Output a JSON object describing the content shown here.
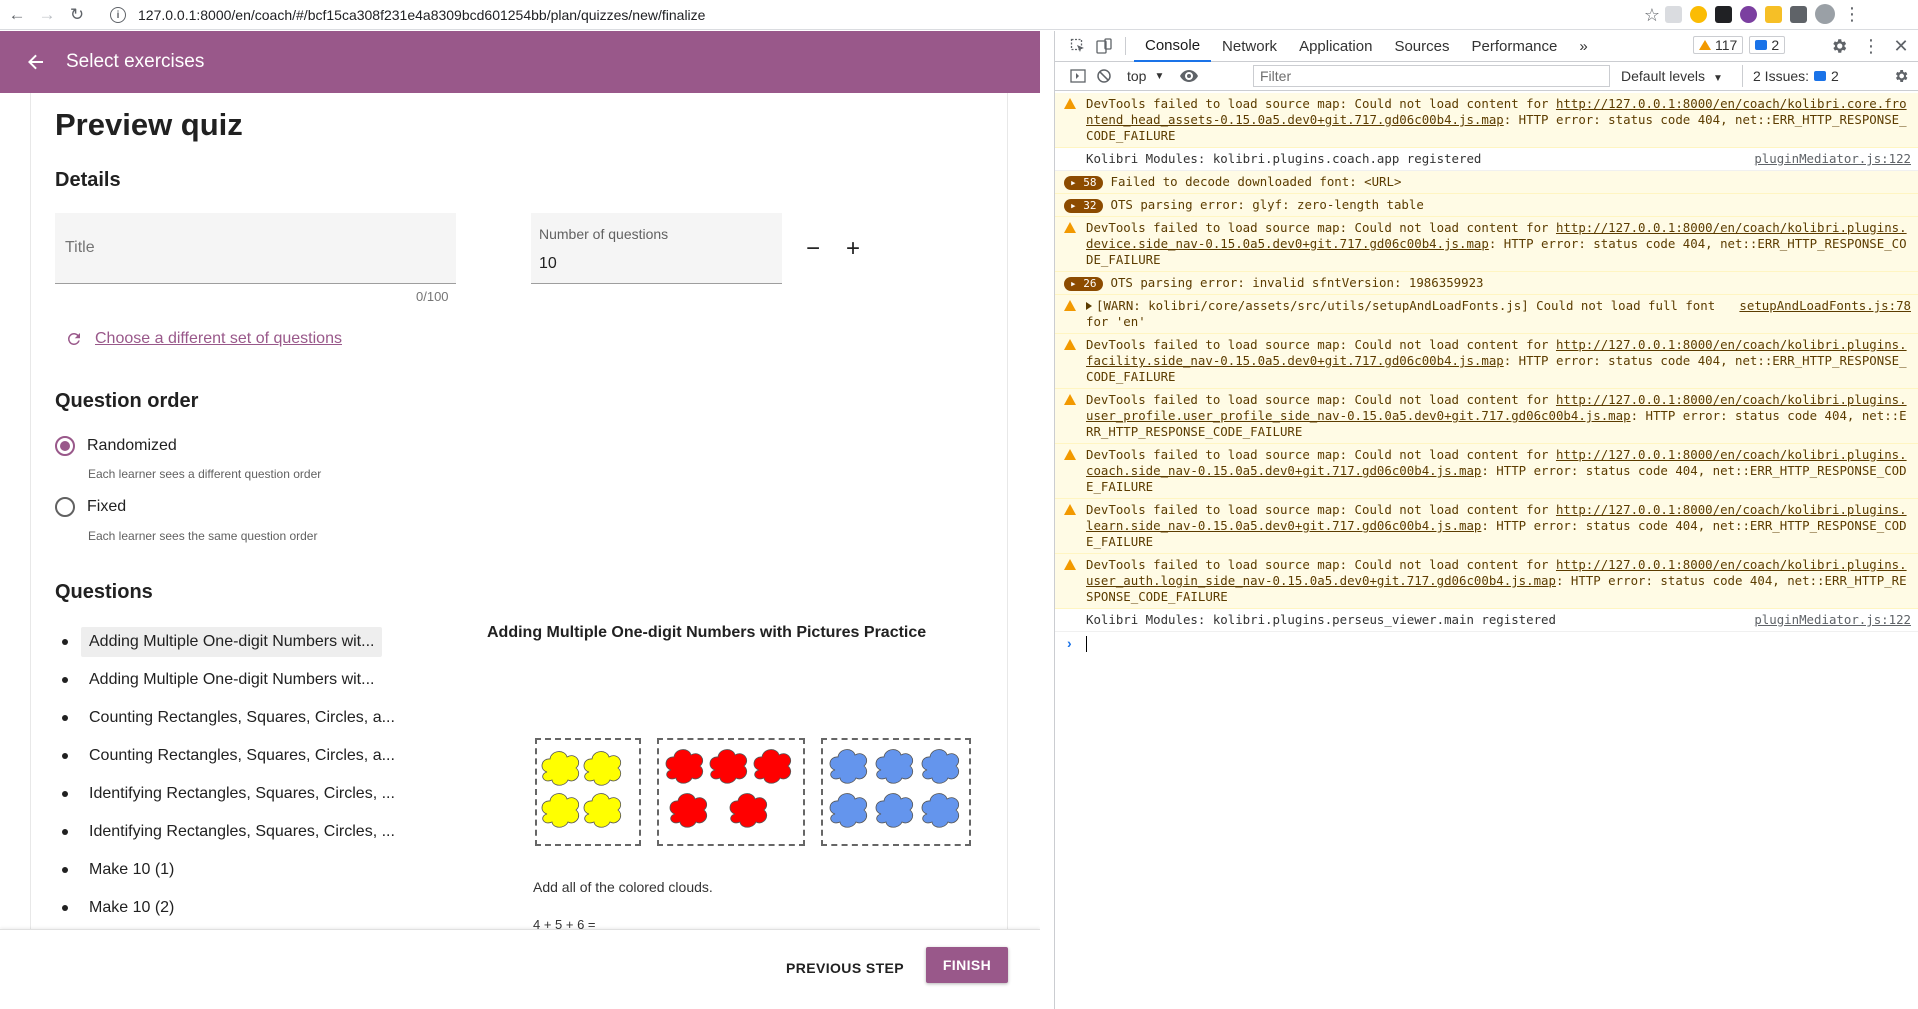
{
  "browser": {
    "url": "127.0.0.1:8000/en/coach/#/bcf15ca308f231e4a8309bcd601254bb/plan/quizzes/new/finalize"
  },
  "appbar": {
    "title": "Select exercises"
  },
  "page": {
    "title": "Preview quiz",
    "details_heading": "Details",
    "title_placeholder": "Title",
    "title_counter": "0/100",
    "num_questions_label": "Number of questions",
    "num_questions_value": "10",
    "minus_symbol": "−",
    "plus_symbol": "+",
    "choose_different": "Choose a different set of questions",
    "question_order_heading": "Question order",
    "randomized_label": "Randomized",
    "randomized_desc": "Each learner sees a different question order",
    "fixed_label": "Fixed",
    "fixed_desc": "Each learner sees the same question order",
    "questions_heading": "Questions",
    "questions": [
      "Adding Multiple One-digit Numbers wit...",
      "Adding Multiple One-digit Numbers wit...",
      "Counting Rectangles, Squares, Circles, a...",
      "Counting Rectangles, Squares, Circles, a...",
      "Identifying Rectangles, Squares, Circles, ...",
      "Identifying Rectangles, Squares, Circles, ...",
      "Make 10 (1)",
      "Make 10 (2)"
    ],
    "preview_title": "Adding Multiple One-digit Numbers with Pictures Practice",
    "preview_prompt": "Add all of the colored clouds.",
    "preview_equation": "4 + 5 + 6 = ___",
    "cloud_colors": [
      "#ffff00",
      "#ff0000",
      "#6495ed"
    ],
    "cloud_counts": [
      4,
      5,
      6
    ]
  },
  "footer": {
    "previous_step": "PREVIOUS STEP",
    "finish": "FINISH"
  },
  "devtools": {
    "tabs": [
      "Console",
      "Network",
      "Application",
      "Sources",
      "Performance"
    ],
    "more_tabs": "»",
    "warnings_count": "117",
    "messages_count": "2",
    "context": "top",
    "filter_placeholder": "Filter",
    "levels": "Default levels",
    "issues": "2 Issues:",
    "issues_count": "2",
    "logs": [
      {
        "type": "warn",
        "text": "DevTools failed to load source map: Could not load content for ",
        "link": "http://127.0.0.1:8000/en/coach/kolibri.core.frontend_head_assets-0.15.0a5.dev0+git.717.gd06c00b4.js.map",
        "tail": ": HTTP error: status code 404, net::ERR_HTTP_RESPONSE_CODE_FAILURE"
      },
      {
        "type": "info",
        "text": "Kolibri Modules: kolibri.plugins.coach.app registered",
        "src": "pluginMediator.js:122"
      },
      {
        "type": "count",
        "count": "58",
        "text": "Failed to decode downloaded font: <URL>"
      },
      {
        "type": "count",
        "count": "32",
        "text": "OTS parsing error: glyf: zero-length table"
      },
      {
        "type": "warn",
        "text": "DevTools failed to load source map: Could not load content for ",
        "link": "http://127.0.0.1:8000/en/coach/kolibri.plugins.device.side_nav-0.15.0a5.dev0+git.717.gd06c00b4.js.map",
        "tail": ": HTTP error: status code 404, net::ERR_HTTP_RESPONSE_CODE_FAILURE"
      },
      {
        "type": "count",
        "count": "26",
        "text": "OTS parsing error: invalid sfntVersion: 1986359923"
      },
      {
        "type": "warnexp",
        "text": "[WARN: kolibri/core/assets/src/utils/setupAndLoadFonts.js] Could not load full font for 'en'",
        "src": "setupAndLoadFonts.js:78"
      },
      {
        "type": "warn",
        "text": "DevTools failed to load source map: Could not load content for ",
        "link": "http://127.0.0.1:8000/en/coach/kolibri.plugins.facility.side_nav-0.15.0a5.dev0+git.717.gd06c00b4.js.map",
        "tail": ": HTTP error: status code 404, net::ERR_HTTP_RESPONSE_CODE_FAILURE"
      },
      {
        "type": "warn",
        "text": "DevTools failed to load source map: Could not load content for ",
        "link": "http://127.0.0.1:8000/en/coach/kolibri.plugins.user_profile.user_profile_side_nav-0.15.0a5.dev0+git.717.gd06c00b4.js.map",
        "tail": ": HTTP error: status code 404, net::ERR_HTTP_RESPONSE_CODE_FAILURE"
      },
      {
        "type": "warn",
        "text": "DevTools failed to load source map: Could not load content for ",
        "link": "http://127.0.0.1:8000/en/coach/kolibri.plugins.coach.side_nav-0.15.0a5.dev0+git.717.gd06c00b4.js.map",
        "tail": ": HTTP error: status code 404, net::ERR_HTTP_RESPONSE_CODE_FAILURE"
      },
      {
        "type": "warn",
        "text": "DevTools failed to load source map: Could not load content for ",
        "link": "http://127.0.0.1:8000/en/coach/kolibri.plugins.learn.side_nav-0.15.0a5.dev0+git.717.gd06c00b4.js.map",
        "tail": ": HTTP error: status code 404, net::ERR_HTTP_RESPONSE_CODE_FAILURE"
      },
      {
        "type": "warn",
        "text": "DevTools failed to load source map: Could not load content for ",
        "link": "http://127.0.0.1:8000/en/coach/kolibri.plugins.user_auth.login_side_nav-0.15.0a5.dev0+git.717.gd06c00b4.js.map",
        "tail": ": HTTP error: status code 404, net::ERR_HTTP_RESPONSE_CODE_FAILURE"
      },
      {
        "type": "info",
        "text": "Kolibri Modules: kolibri.plugins.perseus_viewer.main registered",
        "src": "pluginMediator.js:122"
      }
    ]
  }
}
